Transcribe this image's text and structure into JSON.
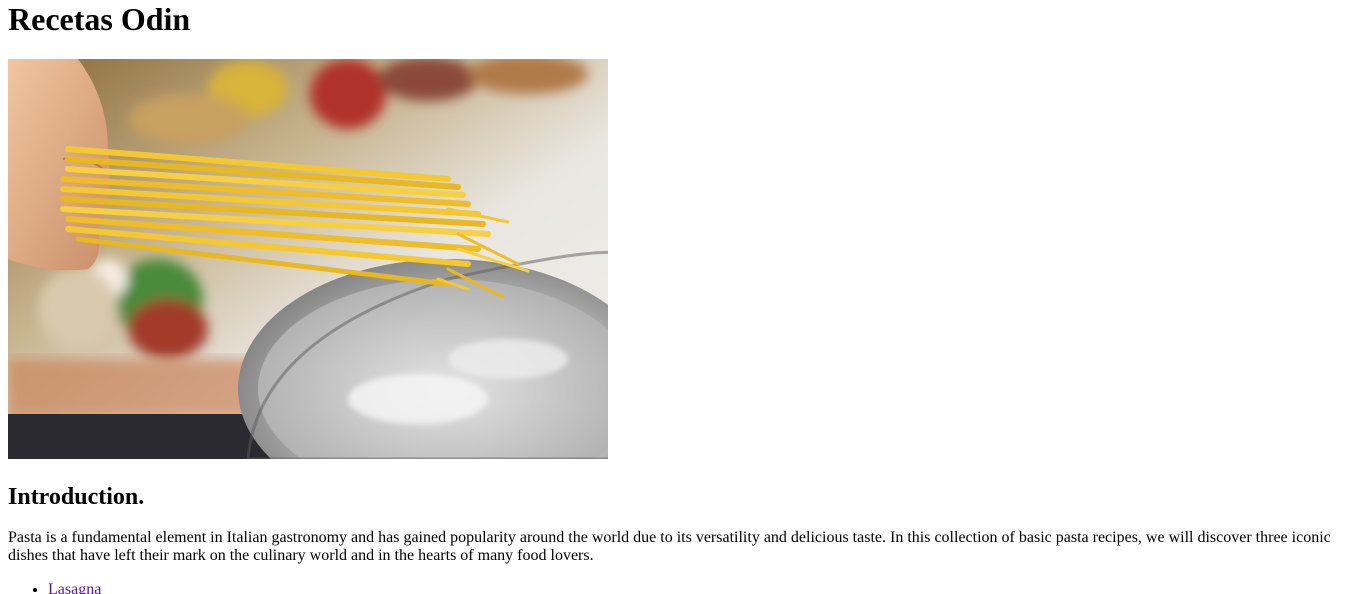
{
  "page": {
    "title": "Recetas Odin"
  },
  "hero_image": {
    "icon": "pasta-photo",
    "subject": "spaghetti over a pot of boiling water"
  },
  "intro": {
    "heading": "Introduction.",
    "paragraph": "Pasta is a fundamental element in Italian gastronomy and has gained popularity around the world due to its versatility and delicious taste. In this collection of basic pasta recipes, we will discover three iconic dishes that have left their mark on the culinary world and in the hearts of many food lovers."
  },
  "recipes": {
    "items": [
      {
        "label": "Lasagna"
      }
    ]
  },
  "colors": {
    "visited_link": "#551a8b",
    "text": "#000000",
    "background": "#ffffff"
  }
}
